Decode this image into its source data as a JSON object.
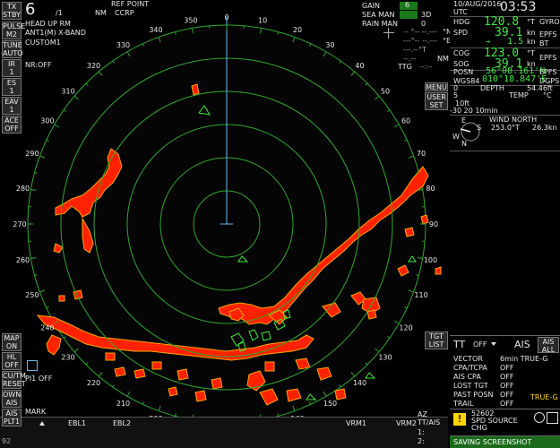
{
  "top_left": {
    "tx_stby": [
      "TX",
      "STBY"
    ],
    "range": "6",
    "range_ring": "/1",
    "range_unit": "NM",
    "ref_point": [
      "REF POINT",
      "CCRP"
    ],
    "head_up": "HEAD UP RM",
    "antenna": "ANT1(M) X-BAND",
    "custom": "CUSTOM1",
    "nr": "NR:OFF"
  },
  "gain": {
    "gain_label": "GAIN",
    "gain_val": "6",
    "sea_label": "SEA MAN",
    "sea_val": "3D",
    "rain_label": "RAIN MAN",
    "rain_val": "0"
  },
  "left_buttons": [
    {
      "label": [
        "PULSE",
        "M2"
      ],
      "name": "pulse-button"
    },
    {
      "label": [
        "TUNE",
        "AUTO"
      ],
      "name": "tune-button"
    },
    {
      "label": [
        "IR",
        "1"
      ],
      "name": "ir-button"
    },
    {
      "label": [
        "ES",
        "1"
      ],
      "name": "es-button"
    },
    {
      "label": [
        "EAV",
        "1"
      ],
      "name": "eav-button"
    },
    {
      "label": [
        "ACE",
        "OFF"
      ],
      "name": "ace-button"
    }
  ],
  "left_lower_buttons": [
    {
      "label": [
        "MAP",
        "ON"
      ],
      "name": "map-button"
    },
    {
      "label": [
        "HL",
        "OFF"
      ],
      "name": "hl-button"
    },
    {
      "label": [
        "CU/TM",
        "RESET"
      ],
      "name": "cu-tm-reset-button"
    },
    {
      "label": [
        "OWN",
        "AIS"
      ],
      "name": "own-ais-button"
    },
    {
      "label": [
        "AIS",
        "PLT1"
      ],
      "name": "ais-plt-button"
    }
  ],
  "pi_off": "PI1 OFF",
  "mark_label": "MARK",
  "bottom_num": "92",
  "bottom_bar": {
    "ebl1": "EBL1",
    "ebl2": "EBL2",
    "vrm1": "VRM1",
    "vrm2": "VRM2",
    "az": [
      "AZ",
      "TT/AIS",
      "1:",
      "2:"
    ]
  },
  "compass_labels": [
    "350",
    "0",
    "10",
    "20",
    "30",
    "40",
    "50",
    "60",
    "70",
    "80",
    "90",
    "100",
    "110",
    "120",
    "130",
    "140",
    "150",
    "160",
    "170",
    "180",
    "190",
    "200",
    "210",
    "220",
    "230",
    "240",
    "250",
    "260",
    "270",
    "280",
    "290",
    "300",
    "310",
    "320",
    "330",
    "340"
  ],
  "right_panel": {
    "date": "10/AUG/2016",
    "utc": "UTC",
    "time": "03:53",
    "hdg_label": "HDG",
    "hdg_val": "120.8",
    "hdg_unit": "°T",
    "hdg_src": "GYRO",
    "spd_label": "SPD",
    "spd_val": "39.1",
    "spd_unit": "kn",
    "spd_src": "EPFS",
    "arrow_val": "1.5",
    "arrow_unit": "kn",
    "bt": "BT",
    "cog_label": "COG",
    "cog_val": "123.0",
    "cog_unit": "°T",
    "cog_src": "EPFS",
    "sog_label": "SOG",
    "sog_val": "39.1",
    "sog_unit": "kn",
    "posn_label": "POSN",
    "posn_lat": "56°08.161'N",
    "posn_lon": "010°18.847'E",
    "posn_src": "EPFS",
    "wgs": "WGS84",
    "dgps": "DGPS",
    "cursor_n": "°N",
    "cursor_e": "°E",
    "nm": "NM",
    "ttg": "TTG",
    "depth_label": "DEPTH",
    "depth_val": "54.46ft",
    "depth_0": "0",
    "temp_label": "TEMP",
    "temp_val": "°C",
    "temp_5": "5",
    "depth_10": "10ft",
    "depth_scale": "-30 20 10min",
    "wind_label": "WIND NORTH",
    "wind_dir": "253.0°T",
    "wind_spd": "26.3kn",
    "menu": "MENU",
    "user_set": [
      "USER",
      "SET"
    ],
    "tgt_list": [
      "TGT",
      "LIST"
    ],
    "compass_n": "N",
    "compass_w": "W",
    "compass_s": "S",
    "compass_e": "E"
  },
  "target_panel": {
    "tt_label": "TT",
    "tt_val": "OFF",
    "ais_label": "AIS",
    "ais_all": [
      "AIS",
      "ALL"
    ],
    "rows": [
      {
        "label": "VECTOR",
        "val": "6min TRUE-G"
      },
      {
        "label": "CPA/TCPA",
        "val": "OFF"
      },
      {
        "label": "AIS CPA",
        "val": "OFF"
      },
      {
        "label": "LOST TGT",
        "val": "OFF"
      },
      {
        "label": "PAST POSN",
        "val": "OFF"
      },
      {
        "label": "TRAIL",
        "val": "OFF"
      }
    ],
    "true_g": "TRUE-G",
    "alarm_code": "52602",
    "alarm_text": [
      "SPD SOURCE",
      "CHG"
    ],
    "status": "SAVING SCREENSHOT"
  },
  "colors": {
    "echo_red": "#ff2200",
    "echo_border": "#ffa500",
    "ring_green": "#2ea82e",
    "scope_bg": "#000000",
    "text_green": "#3bea3b"
  }
}
